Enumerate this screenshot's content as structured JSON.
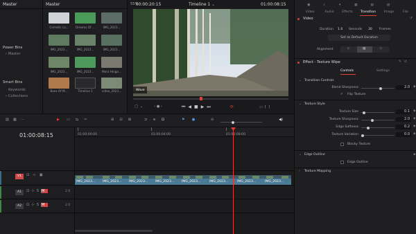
{
  "bins": {
    "title": "Master",
    "groups": [
      {
        "label": "Power Bins",
        "item": "Master"
      },
      {
        "label": "Smart Bins",
        "items": [
          "Keywords",
          "Collections"
        ]
      }
    ]
  },
  "media": {
    "title": "Master",
    "items": [
      "Cometic co...",
      "Dreams Of ...",
      "IMG_2023...",
      "IMG_2023...",
      "IMG_2023...",
      "IMG_2023...",
      "IMG_2023...",
      "IMG_2023...",
      "Mera Hinga...",
      "Bans Of M...",
      "Timeline 1",
      "video_2023..."
    ]
  },
  "viewer": {
    "zoom": "55%",
    "timecode_left": "00:00:20:15",
    "timeline_name": "Timeline 1",
    "timecode_right": "01:00:08:15",
    "overlay_label": "Wave"
  },
  "inspector": {
    "tabs": [
      "Video",
      "Audio",
      "Effects",
      "Transition",
      "Image",
      "File"
    ],
    "active_tab": "Transition",
    "video": {
      "title": "Video",
      "duration_label": "Duration",
      "duration_value": "1.0",
      "seconds_label": "Seconds",
      "frames_value": "30",
      "frames_label": "Frames",
      "default_button": "Set as Default Duration",
      "alignment_label": "Alignment"
    },
    "effect": {
      "title": "Effect - Texture Wipe",
      "subtabs": [
        "Controls",
        "Settings"
      ],
      "transition_controls": "Transition Controls",
      "blend_label": "Blend Sharpness",
      "blend_value": "2.0",
      "flip_label": "Flip Texture",
      "texture_style": "Texture Style",
      "texture_size_label": "Texture Size",
      "texture_size_value": "0.1",
      "texture_sharpness_label": "Texture Sharpness",
      "texture_sharpness_value": "2.0",
      "edge_softness_label": "Edge Softness",
      "edge_softness_value": "0.2",
      "texture_variation_label": "Texture Variation",
      "texture_variation_value": "0.0",
      "blocky_label": "Blocky Texture",
      "edge_outline": "Edge Outline",
      "edge_outline_check": "Edge Outline",
      "texture_mapping": "Texture Mapping"
    }
  },
  "timeline": {
    "timecode": "01:00:08:15",
    "ruler": [
      "01:00:00:00",
      "01:00:04:00",
      "01:00:08:00"
    ],
    "tracks": [
      {
        "name": "V1"
      },
      {
        "name": "A1",
        "level": "2.0"
      },
      {
        "name": "A2",
        "level": "2.0"
      }
    ],
    "video_clips": [
      "IMG_2023...",
      "IMG_2023...",
      "IMG_2023...",
      "IMG_2023...",
      "IMG_2023...",
      "IMG_2023...",
      "IMG_2023...",
      "IMG_2023..."
    ]
  },
  "colors": {
    "accent_red": "#e0403c",
    "playhead": "#e03a3a",
    "clip_blue": "#3d6b86"
  }
}
